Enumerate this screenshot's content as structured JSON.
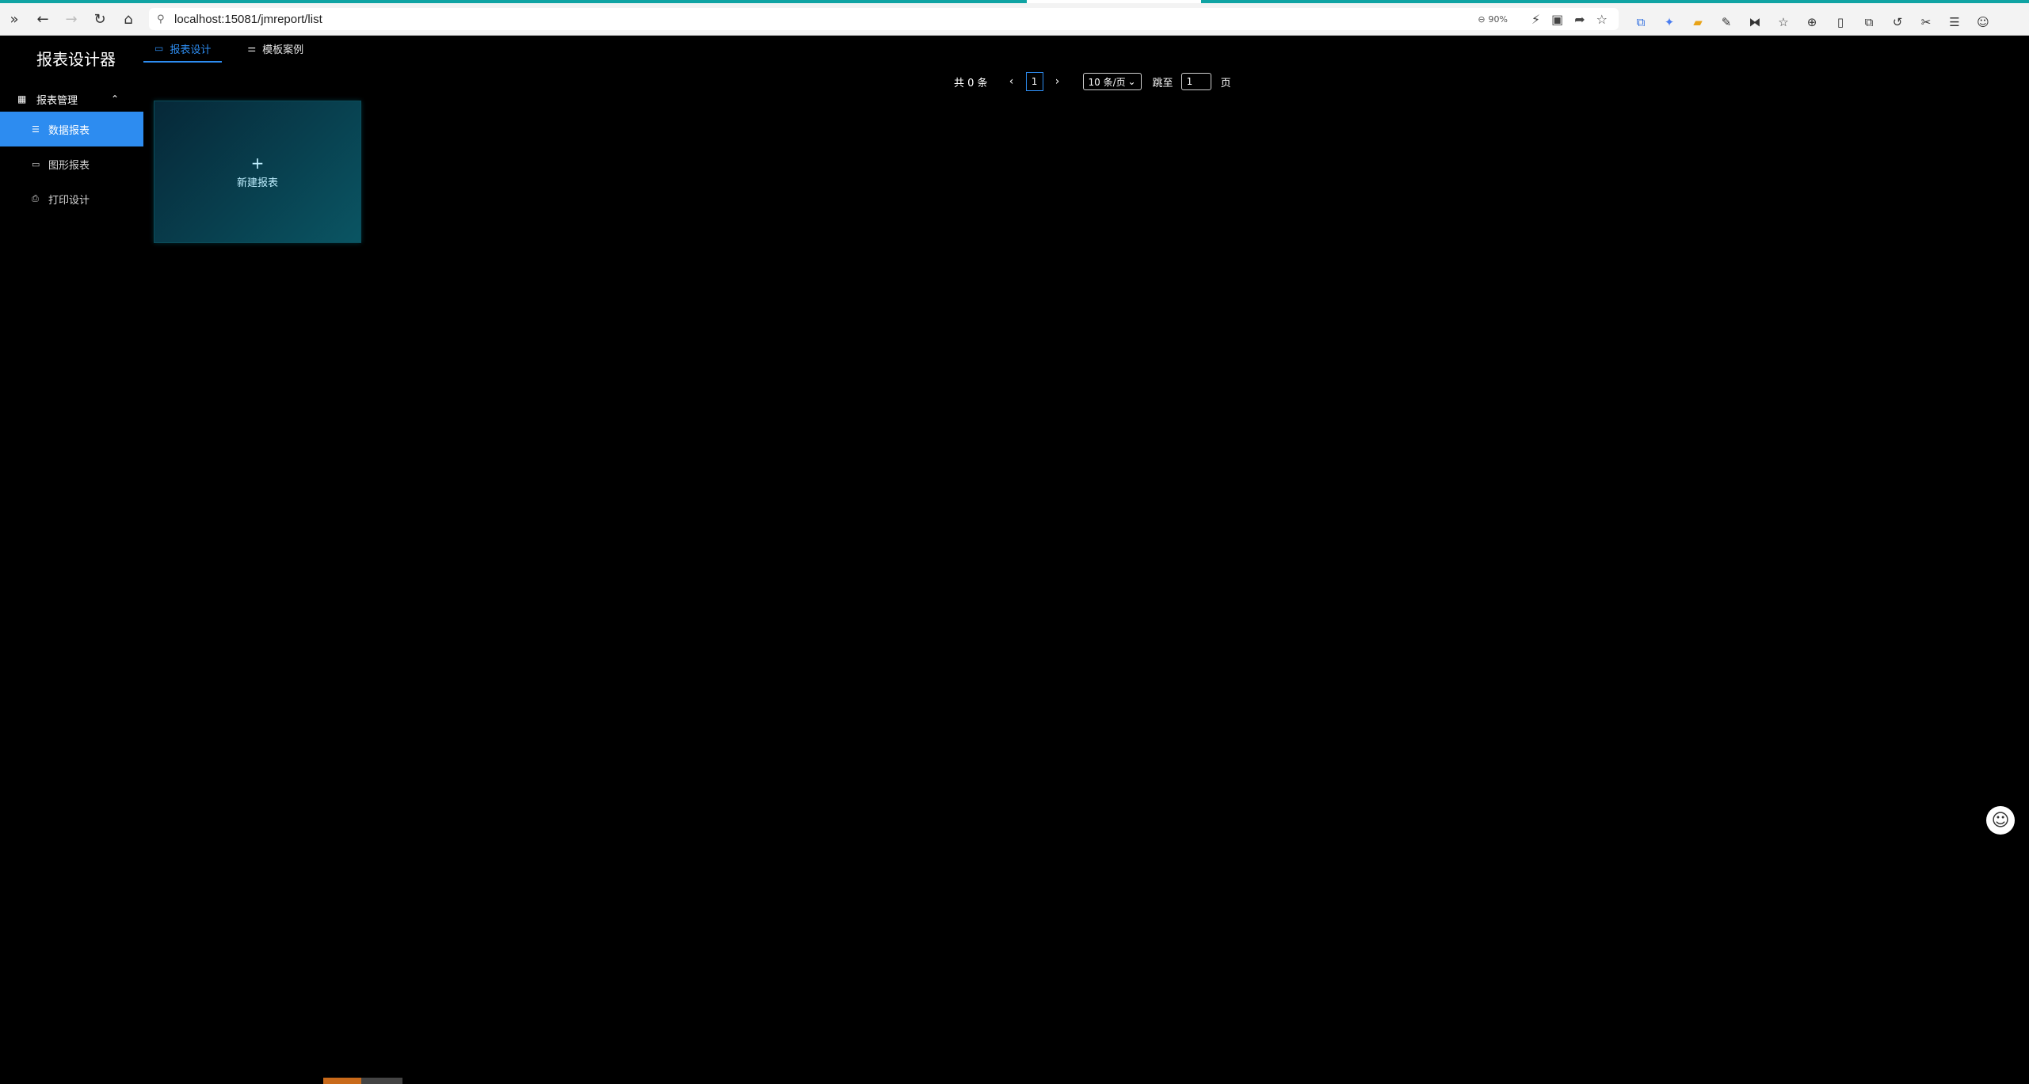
{
  "browser": {
    "url": "localhost:15081/jmreport/list",
    "zoom": "90%"
  },
  "sidebar": {
    "title": "报表设计器",
    "group": {
      "label": "报表管理"
    },
    "items": [
      {
        "label": "数据报表",
        "icon": "list-icon",
        "active": true
      },
      {
        "label": "图形报表",
        "icon": "chart-icon",
        "active": false
      },
      {
        "label": "打印设计",
        "icon": "printer-icon",
        "active": false
      }
    ]
  },
  "tabs": [
    {
      "label": "报表设计",
      "icon": "monitor-icon",
      "active": true
    },
    {
      "label": "模板案例",
      "icon": "sliders-icon",
      "active": false
    }
  ],
  "pagination": {
    "total": "共 0 条",
    "current_page": "1",
    "page_size": "10 条/页",
    "jump_label": "跳至",
    "jump_value": "1",
    "page_unit": "页"
  },
  "new_report": {
    "plus": "+",
    "label": "新建报表"
  },
  "colors": {
    "accent": "#2d8cf0",
    "card_start": "#062838",
    "card_end": "#0a5563",
    "background": "#000000"
  }
}
